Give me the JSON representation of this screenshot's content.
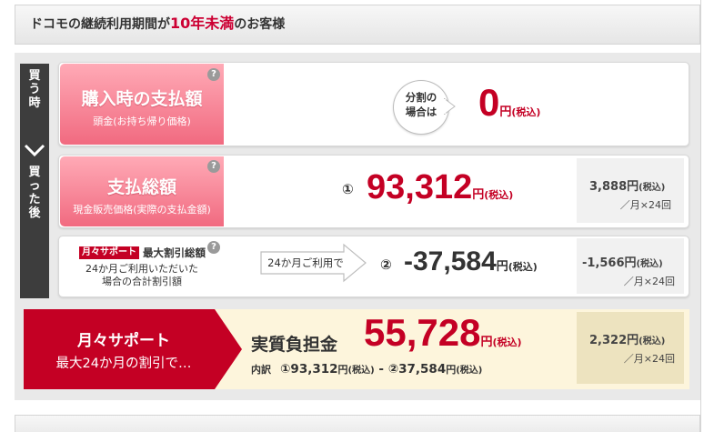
{
  "header": {
    "prefix": "ドコモの継続利用期間が",
    "hl_a": "10年",
    "hl_b": "未",
    "hl_c": "満",
    "suffix": "のお客様"
  },
  "side_tab": {
    "buy_time": [
      "買",
      "う",
      "時"
    ],
    "after_buy": [
      "買",
      "っ",
      "た",
      "後"
    ]
  },
  "row1": {
    "title": "購入時の支払額",
    "subtitle": "頭金(お持ち帰り価格)",
    "help": "?",
    "bubble_line1": "分割の",
    "bubble_line2": "場合は",
    "amount": "0",
    "unit": "円",
    "tax": "(税込)"
  },
  "row2": {
    "title": "支払総額",
    "subtitle": "現金販売価格(実際の支払金額)",
    "help": "?",
    "marker": "①",
    "amount": "93,312",
    "unit": "円",
    "tax": "(税込)",
    "monthly_amount": "3,888円",
    "monthly_tax": "(税込)",
    "monthly_term": "／月×24回"
  },
  "row3": {
    "badge": "月々サポート",
    "title": "最大割引総額",
    "desc1": "24か月ご利用いただいた",
    "desc2": "場合の合計割引額",
    "help": "?",
    "arrow_label": "24か月ご利用で",
    "marker": "②",
    "amount": "-37,584",
    "unit": "円",
    "tax": "(税込)",
    "monthly_amount": "-1,566円",
    "monthly_tax": "(税込)",
    "monthly_term": "／月×24回"
  },
  "bottom": {
    "brand": "月々サポート",
    "tagline": "最大24か月の割引で…",
    "label": "実質負担金",
    "amount": "55,728",
    "unit": "円",
    "tax": "(税込)",
    "breakdown_label": "内訳",
    "breakdown_a": "①93,312",
    "breakdown_a_unit": "円",
    "breakdown_a_tax": "(税込)",
    "breakdown_sep": " - ",
    "breakdown_b": "②37,584",
    "breakdown_b_unit": "円",
    "breakdown_b_tax": "(税込)",
    "monthly_amount": "2,322円",
    "monthly_tax": "(税込)",
    "monthly_term": "／月×24回"
  },
  "colors": {
    "accent_red": "#c40024",
    "pink": "#f16a80",
    "dark_tab": "#3d3d3d",
    "cream": "#fdf5dc"
  }
}
